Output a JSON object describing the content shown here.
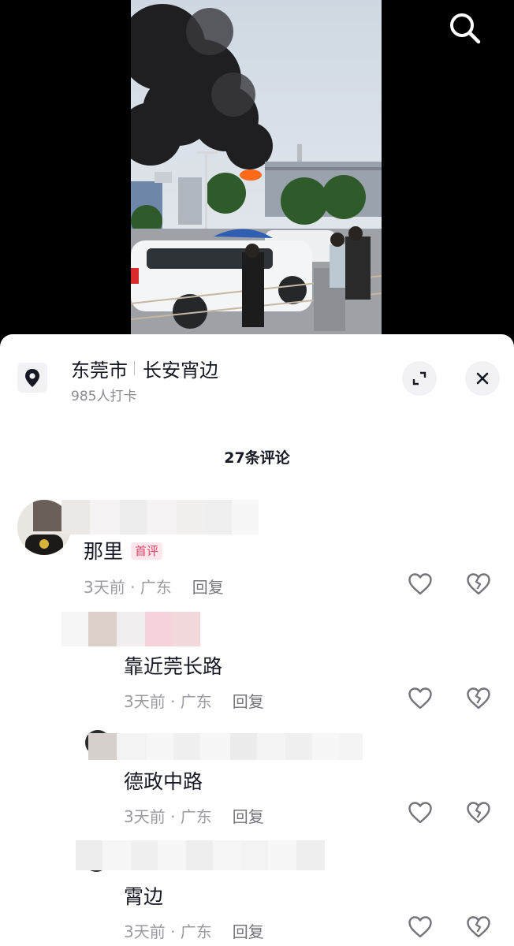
{
  "header": {
    "search_icon": "search-icon"
  },
  "location": {
    "city": "东莞市",
    "place": "长安宵边",
    "checkins": "985人打卡"
  },
  "comments_title": "27条评论",
  "comments": [
    {
      "text": "那里",
      "badge": "首评",
      "time": "3天前 · 广东",
      "reply": "回复"
    },
    {
      "text": "靠近莞长路",
      "time": "3天前 · 广东",
      "reply": "回复"
    },
    {
      "text": "德政中路",
      "time": "3天前 · 广东",
      "reply": "回复"
    },
    {
      "text": "霄边",
      "time": "3天前 · 广东",
      "reply": "回复"
    }
  ],
  "colors": {
    "accent_pink": "#f0446b",
    "text_primary": "#161823",
    "text_secondary": "#9a9ba1"
  }
}
